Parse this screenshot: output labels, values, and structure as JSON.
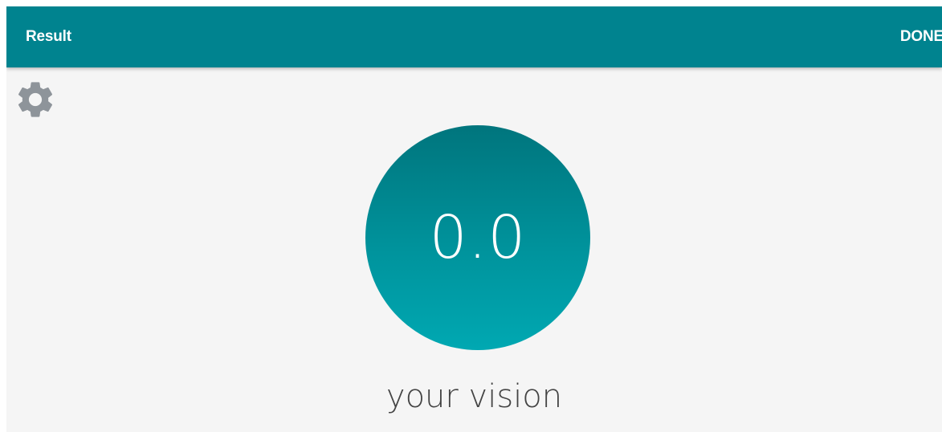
{
  "app_bar": {
    "title": "Result",
    "done_label": "DONE",
    "background_color": "#00838f"
  },
  "settings": {
    "icon": "gear-icon",
    "color": "#8e949a"
  },
  "result": {
    "score": "0.0",
    "label": "your vision",
    "circle_color_top": "#00757d",
    "circle_color_bottom": "#00a8b2"
  }
}
